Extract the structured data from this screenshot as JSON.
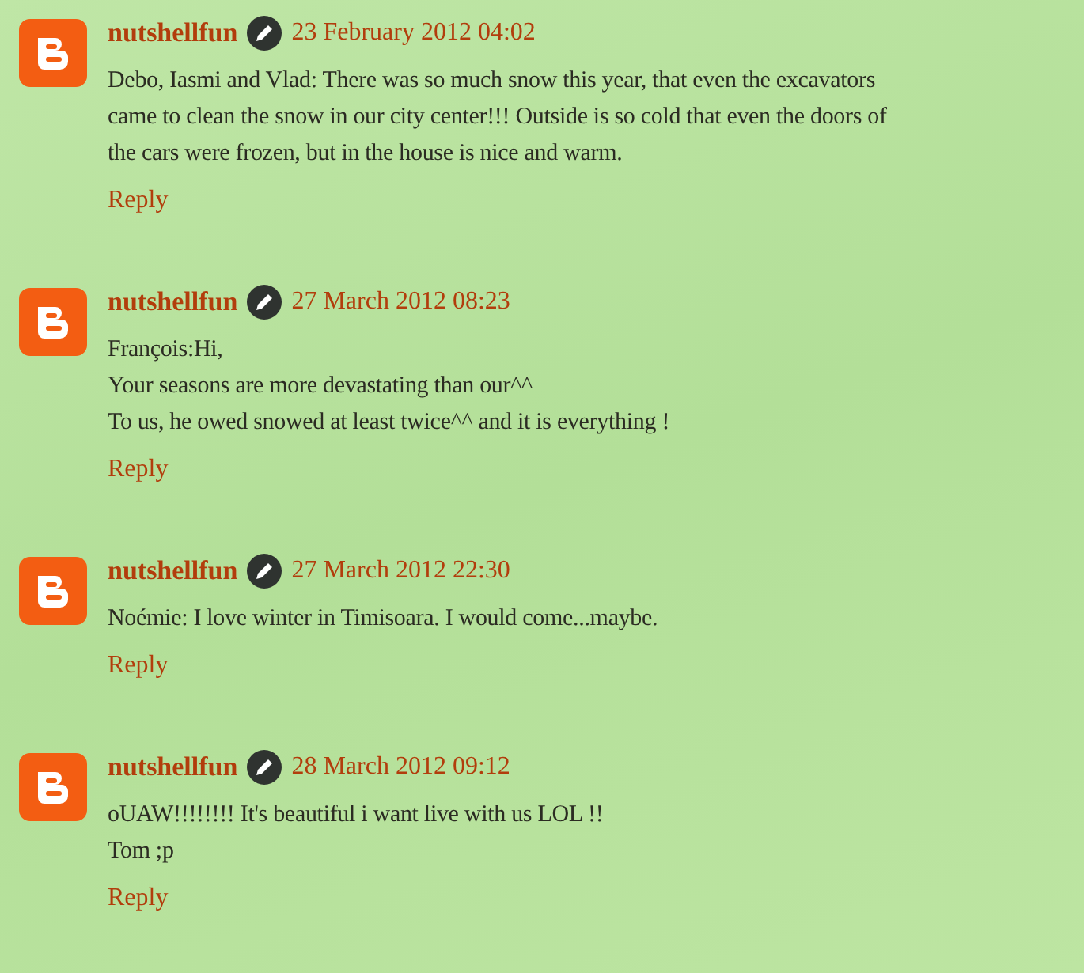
{
  "comments": [
    {
      "author": "nutshellfun",
      "date": "23 February 2012 04:02",
      "lines": [
        "Debo, Iasmi and Vlad: There was so much snow this year, that even the excavators",
        "came to clean the snow in our city center!!! Outside is so cold that even the doors of",
        "the cars were frozen, but in the house is nice and warm."
      ],
      "reply": "Reply"
    },
    {
      "author": "nutshellfun",
      "date": "27 March 2012 08:23",
      "lines": [
        "François:Hi,",
        "Your seasons are more devastating than our^^",
        "To us, he owed snowed at least twice^^ and it is everything !"
      ],
      "reply": "Reply"
    },
    {
      "author": "nutshellfun",
      "date": "27 March 2012 22:30",
      "lines": [
        "Noémie: I love winter in Timisoara. I would come...maybe."
      ],
      "reply": "Reply"
    },
    {
      "author": "nutshellfun",
      "date": "28 March 2012 09:12",
      "lines": [
        "oUAW!!!!!!!! It's beautiful i want live with us LOL !!",
        "Tom ;p"
      ],
      "reply": "Reply"
    }
  ]
}
